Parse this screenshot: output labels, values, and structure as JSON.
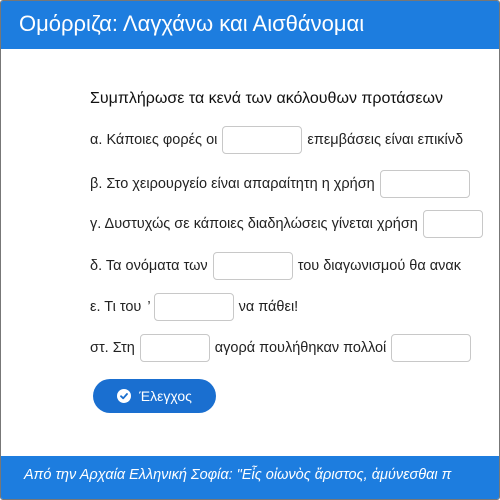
{
  "header": {
    "title": "Ομόρριζα: Λαγχάνω και Αισθάνομαι"
  },
  "instructions": "Συμπλήρωσε τα κενά των ακόλουθων προτάσεων",
  "questions": [
    {
      "before": "α. Κάποιες φορές οι",
      "after": "επεμβάσεις είναι επικίνδ"
    },
    {
      "before": "β. Στο χειρουργείο είναι απαραίτητη η χρήση",
      "after": ""
    },
    {
      "before": "γ. Δυστυχώς σε κάποιες διαδηλώσεις γίνεται χρήση",
      "after": ""
    },
    {
      "before": "δ. Τα ονόματα των",
      "after": "του διαγωνισμού θα ανακ"
    },
    {
      "before": "ε. Τι του",
      "quote": "’",
      "after": "να πάθει!"
    },
    {
      "before": "στ. Στη",
      "after": "αγορά πουλήθηκαν πολλοί"
    }
  ],
  "check_button": {
    "label": "Έλεγχος",
    "icon": "check-circle-icon"
  },
  "footer": {
    "text": "Από την Αρχαία Ελληνική Σοφία: \"Εἷς οἰωνὸς ἄριστος, ἀμύνεσθαι π"
  },
  "colors": {
    "primary": "#1d7ddf",
    "button": "#1a6fd0"
  }
}
